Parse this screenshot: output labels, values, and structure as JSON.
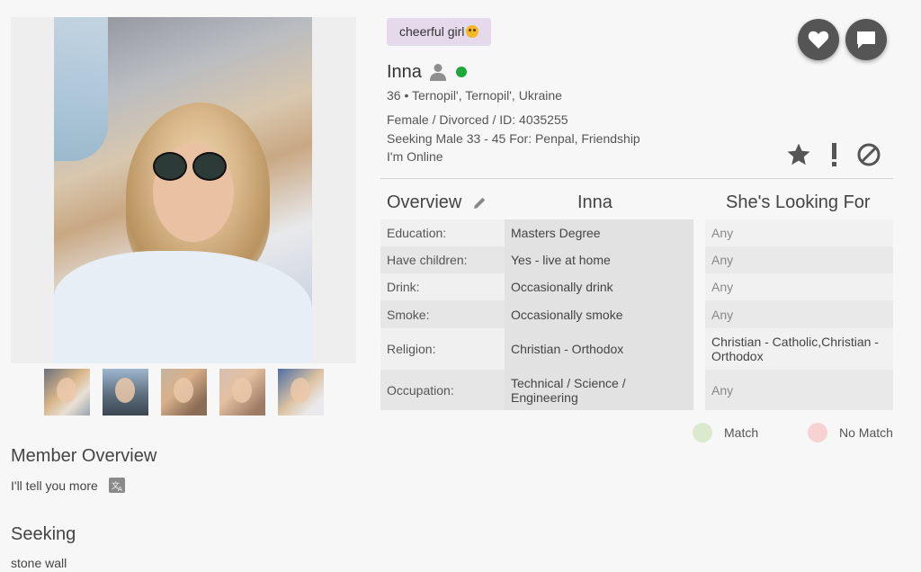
{
  "status": {
    "text": "cheerful girl",
    "emoji": "smiling-face"
  },
  "profile": {
    "name": "Inna",
    "online": true,
    "location": "36 • Ternopil', Ternopil', Ukraine",
    "details": "Female / Divorced / ID: 4035255",
    "seeking_line": "Seeking Male 33 - 45 For: Penpal, Friendship",
    "online_text": "I'm Online"
  },
  "photos": {
    "thumbnail_count": 5
  },
  "member_overview": {
    "title": "Member Overview",
    "text": "I'll tell you more"
  },
  "seeking": {
    "title": "Seeking",
    "text": "stone wall"
  },
  "overview_table": {
    "headers": {
      "overview": "Overview",
      "member": "Inna",
      "looking_for": "She's Looking For"
    },
    "rows": [
      {
        "label": "Education:",
        "value": "Masters Degree",
        "wants": "Any"
      },
      {
        "label": "Have children:",
        "value": "Yes - live at home",
        "wants": "Any"
      },
      {
        "label": "Drink:",
        "value": "Occasionally drink",
        "wants": "Any"
      },
      {
        "label": "Smoke:",
        "value": "Occasionally smoke",
        "wants": "Any"
      },
      {
        "label": "Religion:",
        "value": "Christian - Orthodox",
        "wants": "Christian - Catholic,Christian - Orthodox"
      },
      {
        "label": "Occupation:",
        "value": "Technical / Science / Engineering",
        "wants": "Any"
      }
    ]
  },
  "legend": {
    "match": "Match",
    "no_match": "No Match"
  },
  "colors": {
    "online": "#1fa83a",
    "match": "#dbe9cc",
    "no_match": "#f6d2d2",
    "status_chip": "#e5d9ec",
    "round_button": "#555555"
  },
  "icons": [
    "heart-icon",
    "chat-icon",
    "person-icon",
    "star-icon",
    "exclamation-icon",
    "block-icon",
    "pencil-icon",
    "translate-icon"
  ]
}
